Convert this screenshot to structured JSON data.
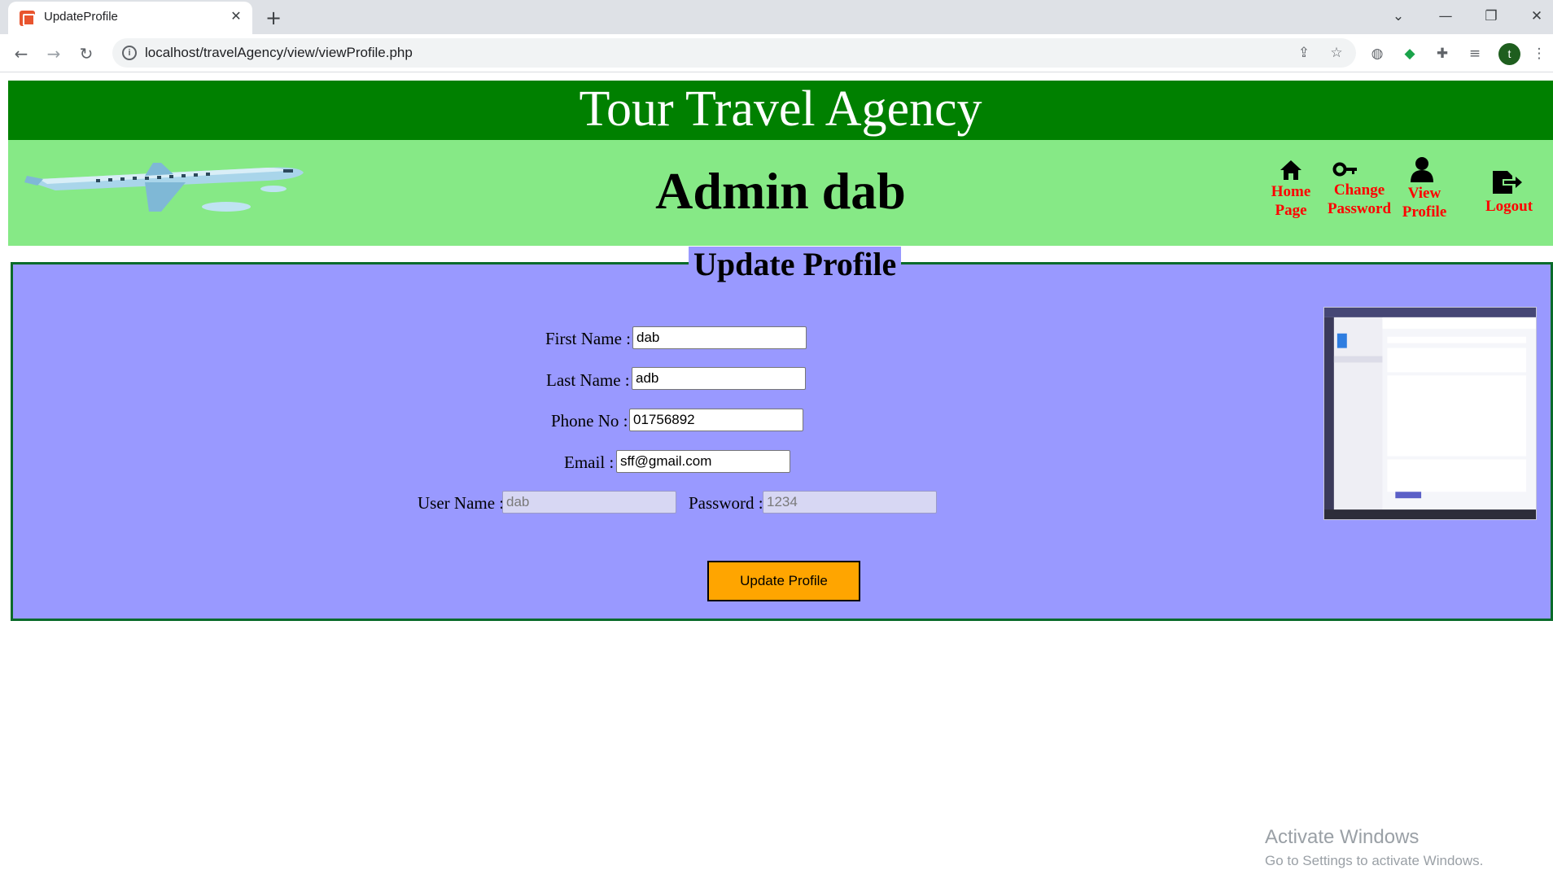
{
  "browser": {
    "tab_title": "UpdateProfile",
    "tab_close": "✕",
    "new_tab": "+",
    "url": "localhost/travelAgency/view/viewProfile.php",
    "avatar_letter": "t",
    "controls": {
      "dropdown": "⌄",
      "minimize": "—",
      "restore": "❐",
      "close": "✕"
    },
    "nav": {
      "back": "←",
      "forward": "→",
      "reload": "↻"
    },
    "icons": [
      "share-icon",
      "star-icon",
      "globe-icon",
      "shield-icon",
      "puzzle-icon",
      "media-icon",
      "menu-icon"
    ]
  },
  "site": {
    "title": "Tour Travel Agency",
    "admin_title": "Admin dab"
  },
  "nav": {
    "home": [
      "Home",
      "Page"
    ],
    "change_password": [
      "Change",
      "Password"
    ],
    "view_profile": [
      "View",
      "Profile"
    ],
    "logout": "Logout",
    "color": "#ff0000"
  },
  "form": {
    "legend": "Update Profile",
    "first_name": {
      "label": "First Name :",
      "value": "dab"
    },
    "last_name": {
      "label": "Last Name :",
      "value": "adb"
    },
    "phone": {
      "label": "Phone No :",
      "value": "01756892"
    },
    "email": {
      "label": "Email :",
      "value": "sff@gmail.com"
    },
    "username": {
      "label": "User Name :",
      "value": "dab"
    },
    "password": {
      "label": "Password :",
      "value": "1234"
    },
    "submit": "Update Profile"
  },
  "watermark": {
    "line1": "Activate Windows",
    "line2": "Go to Settings to activate Windows."
  },
  "colors": {
    "header": "#008000",
    "admin_bar": "#86e986",
    "panel": "#9999ff",
    "button": "#ffa500"
  }
}
